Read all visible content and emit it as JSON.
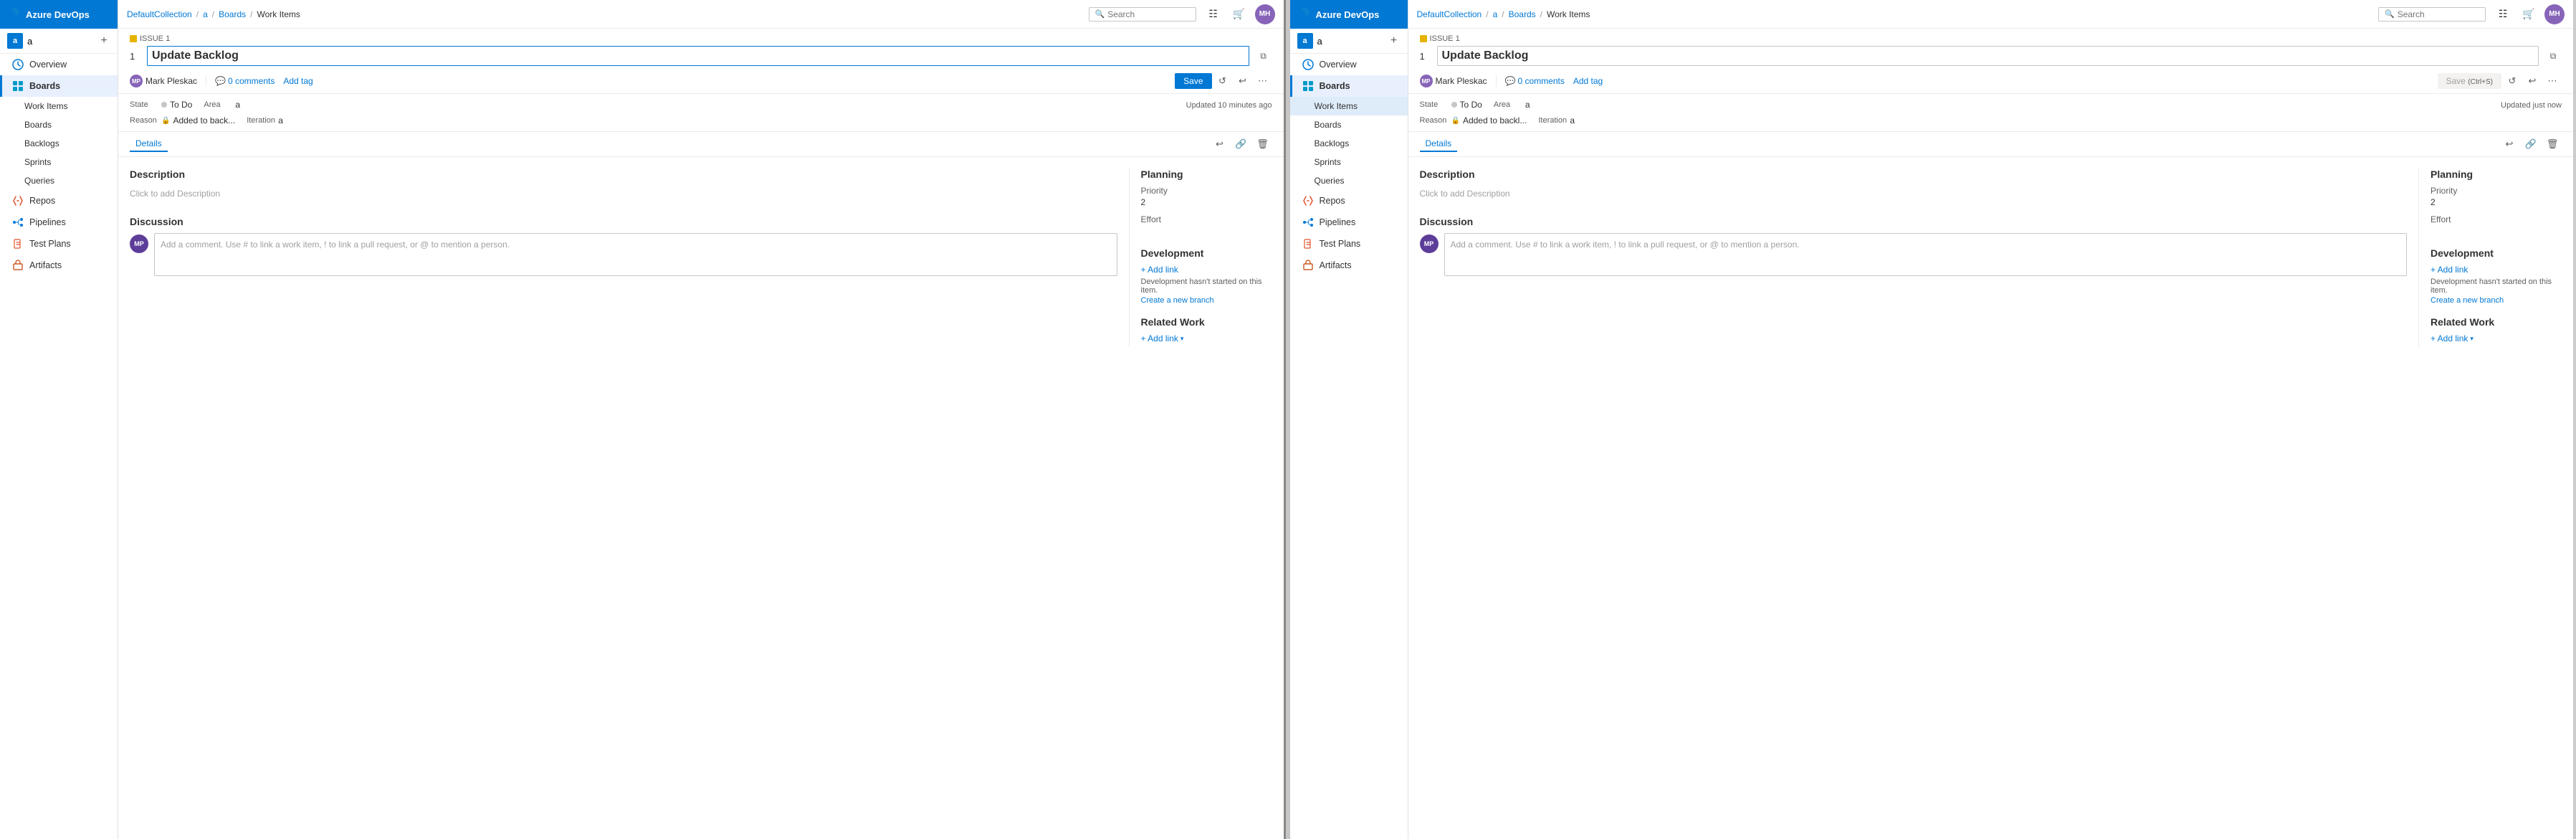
{
  "app": {
    "name": "Azure DevOps",
    "logo_text": "Azure DevOps"
  },
  "panel1": {
    "topbar": {
      "collection": "DefaultCollection",
      "sep1": "/",
      "project": "a",
      "sep2": "/",
      "boards": "Boards",
      "sep3": "/",
      "work_items": "Work Items",
      "search_placeholder": "Search"
    },
    "project": {
      "name": "a",
      "avatar_letter": "a"
    },
    "sidebar": {
      "overview": "Overview",
      "boards_group": "Boards",
      "boards": "Boards",
      "work_items": "Work Items",
      "backlogs": "Backlogs",
      "sprints": "Sprints",
      "queries": "Queries",
      "repos": "Repos",
      "pipelines": "Pipelines",
      "test_plans": "Test Plans",
      "artifacts": "Artifacts"
    },
    "work_item": {
      "issue_label": "ISSUE 1",
      "issue_icon": "▣",
      "number": "1",
      "title": "Update Backlog",
      "assigned_to": "Mark Pleskac",
      "comments_count": "0 comments",
      "add_tag": "Add tag",
      "save_label": "Save",
      "state_label": "State",
      "state_value": "To Do",
      "area_label": "Area",
      "area_value": "a",
      "reason_label": "Reason",
      "reason_value": "Added to back...",
      "iteration_label": "Iteration",
      "iteration_value": "a",
      "updated_text": "Updated 10 minutes ago",
      "details_label": "Details",
      "description_title": "Description",
      "description_placeholder": "Click to add Description",
      "discussion_title": "Discussion",
      "comment_placeholder": "Add a comment. Use # to link a work item, ! to link a pull request, or @ to mention a person.",
      "planning_title": "Planning",
      "priority_label": "Priority",
      "priority_value": "2",
      "effort_label": "Effort",
      "development_title": "Development",
      "add_link_label": "+ Add link",
      "dev_status": "Development hasn't started on this item.",
      "create_branch": "Create a new branch",
      "related_work_title": "Related Work",
      "related_add_link": "+ Add link"
    }
  },
  "panel2": {
    "topbar": {
      "collection": "DefaultCollection",
      "sep1": "/",
      "project": "a",
      "sep2": "/",
      "boards": "Boards",
      "sep3": "/",
      "work_items": "Work Items",
      "search_placeholder": "Search"
    },
    "project": {
      "name": "a",
      "avatar_letter": "a"
    },
    "sidebar": {
      "overview": "Overview",
      "boards_group": "Boards",
      "boards": "Boards",
      "work_items": "Work Items",
      "backlogs": "Backlogs",
      "sprints": "Sprints",
      "queries": "Queries",
      "repos": "Repos",
      "pipelines": "Pipelines",
      "test_plans": "Test Plans",
      "artifacts": "Artifacts"
    },
    "work_item": {
      "issue_label": "ISSUE 1",
      "issue_icon": "▣",
      "number": "1",
      "title": "Update Backlog",
      "assigned_to": "Mark Pleskac",
      "comments_count": "0 comments",
      "add_tag": "Add tag",
      "save_label": "Save",
      "save_shortcut": "(Ctrl+S)",
      "state_label": "State",
      "state_value": "To Do",
      "area_label": "Area",
      "area_value": "a",
      "reason_label": "Reason",
      "reason_value": "Added to backl...",
      "iteration_label": "Iteration",
      "iteration_value": "a",
      "updated_text": "Updated just now",
      "details_label": "Details",
      "description_title": "Description",
      "description_placeholder": "Click to add Description",
      "discussion_title": "Discussion",
      "comment_placeholder": "Add a comment. Use # to link a work item, ! to link a pull request, or @ to mention a person.",
      "planning_title": "Planning",
      "priority_label": "Priority",
      "priority_value": "2",
      "effort_label": "Effort",
      "development_title": "Development",
      "add_link_label": "+ Add link",
      "dev_status": "Development hasn't started on this item.",
      "create_branch": "Create a new branch",
      "related_work_title": "Related Work",
      "related_add_link": "+ Add link"
    }
  },
  "icons": {
    "search": "🔍",
    "grid": "⊞",
    "chat": "💬",
    "settings": "⚙",
    "history": "↩",
    "link": "🔗",
    "trash": "🗑",
    "copy": "⧉",
    "lock": "🔒",
    "refresh": "↺",
    "undo": "↩",
    "more": "⋯",
    "plus": "+",
    "chevron_down": "▾"
  }
}
